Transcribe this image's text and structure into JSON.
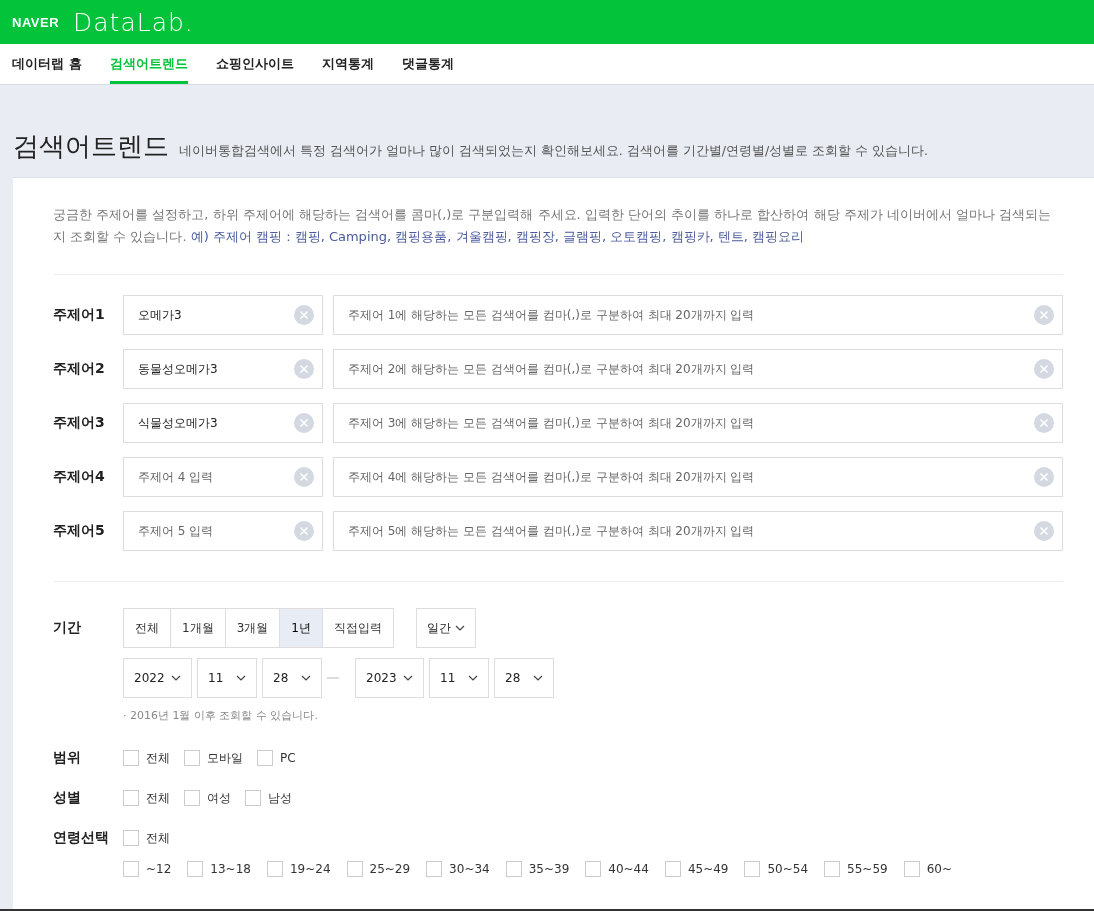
{
  "header": {
    "brand": "NAVER",
    "product": "DataLab."
  },
  "nav": [
    {
      "label": "데이터랩 홈",
      "selected": false
    },
    {
      "label": "검색어트렌드",
      "selected": true
    },
    {
      "label": "쇼핑인사이트",
      "selected": false
    },
    {
      "label": "지역통계",
      "selected": false
    },
    {
      "label": "댓글통계",
      "selected": false
    }
  ],
  "page": {
    "title": "검색어트렌드",
    "subtitle": "네이버통합검색에서 특정 검색어가 얼마나 많이 검색되었는지 확인해보세요. 검색어를 기간별/연령별/성별로 조회할 수 있습니다."
  },
  "intro": {
    "text": "궁금한 주제어를 설정하고, 하위 주제어에 해당하는 검색어를 콤마(,)로 구분입력해 주세요. 입력한 단어의 추이를 하나로 합산하여 해당 주제가 네이버에서 얼마나 검색되는지 조회할 수 있습니다. ",
    "example": "예) 주제어 캠핑 : 캠핑, Camping, 캠핑용품, 겨울캠핑, 캠핑장, 글램핑, 오토캠핑, 캠핑카, 텐트, 캠핑요리"
  },
  "topics": [
    {
      "label": "주제어1",
      "value": "오메가3",
      "keywords_placeholder": "주제어 1에 해당하는 모든 검색어를 컴마(,)로 구분하여 최대 20개까지 입력"
    },
    {
      "label": "주제어2",
      "value": "동물성오메가3",
      "keywords_placeholder": "주제어 2에 해당하는 모든 검색어를 컴마(,)로 구분하여 최대 20개까지 입력"
    },
    {
      "label": "주제어3",
      "value": "식물성오메가3",
      "keywords_placeholder": "주제어 3에 해당하는 모든 검색어를 컴마(,)로 구분하여 최대 20개까지 입력"
    },
    {
      "label": "주제어4",
      "placeholder": "주제어 4 입력",
      "keywords_placeholder": "주제어 4에 해당하는 모든 검색어를 컴마(,)로 구분하여 최대 20개까지 입력"
    },
    {
      "label": "주제어5",
      "placeholder": "주제어 5 입력",
      "keywords_placeholder": "주제어 5에 해당하는 모든 검색어를 컴마(,)로 구분하여 최대 20개까지 입력"
    }
  ],
  "period": {
    "label": "기간",
    "options": [
      {
        "label": "전체",
        "selected": false
      },
      {
        "label": "1개월",
        "selected": false
      },
      {
        "label": "3개월",
        "selected": false
      },
      {
        "label": "1년",
        "selected": true
      },
      {
        "label": "직접입력",
        "selected": false
      }
    ],
    "unit": "일간",
    "start": [
      "2022",
      "11",
      "28"
    ],
    "end": [
      "2023",
      "11",
      "28"
    ],
    "note": "· 2016년 1월 이후 조회할 수 있습니다."
  },
  "scope": {
    "label": "범위",
    "options": [
      {
        "label": "전체",
        "checked": false
      },
      {
        "label": "모바일",
        "checked": false
      },
      {
        "label": "PC",
        "checked": false
      }
    ]
  },
  "gender": {
    "label": "성별",
    "options": [
      {
        "label": "전체",
        "checked": false
      },
      {
        "label": "여성",
        "checked": false
      },
      {
        "label": "남성",
        "checked": false
      }
    ]
  },
  "age": {
    "label": "연령선택",
    "all": {
      "label": "전체",
      "checked": false
    },
    "options": [
      {
        "label": "~12",
        "checked": false
      },
      {
        "label": "13~18",
        "checked": false
      },
      {
        "label": "19~24",
        "checked": false
      },
      {
        "label": "25~29",
        "checked": false
      },
      {
        "label": "30~34",
        "checked": false
      },
      {
        "label": "35~39",
        "checked": false
      },
      {
        "label": "40~44",
        "checked": false
      },
      {
        "label": "45~49",
        "checked": false
      },
      {
        "label": "50~54",
        "checked": false
      },
      {
        "label": "55~59",
        "checked": false
      },
      {
        "label": "60~",
        "checked": false
      }
    ]
  }
}
